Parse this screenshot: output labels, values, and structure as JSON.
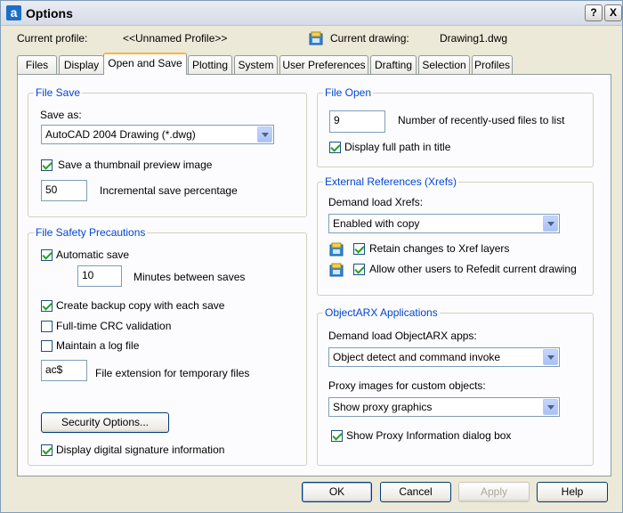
{
  "window": {
    "title": "Options",
    "app_icon_glyph": "a",
    "help_glyph": "?",
    "close_glyph": "X"
  },
  "profile": {
    "current_profile_label": "Current profile:",
    "current_profile_value": "<<Unnamed Profile>>",
    "current_drawing_label": "Current drawing:",
    "current_drawing_value": "Drawing1.dwg"
  },
  "tabs": [
    {
      "label": "Files"
    },
    {
      "label": "Display"
    },
    {
      "label": "Open and Save",
      "active": true
    },
    {
      "label": "Plotting"
    },
    {
      "label": "System"
    },
    {
      "label": "User Preferences"
    },
    {
      "label": "Drafting"
    },
    {
      "label": "Selection"
    },
    {
      "label": "Profiles"
    }
  ],
  "file_save": {
    "legend": "File Save",
    "save_as_label": "Save as:",
    "save_as_value": "AutoCAD 2004 Drawing (*.dwg)",
    "thumbnail_label": "Save a thumbnail preview image",
    "thumbnail_checked": true,
    "incremental_value": "50",
    "incremental_label": "Incremental save percentage"
  },
  "file_safety": {
    "legend": "File Safety Precautions",
    "automatic_save_label": "Automatic save",
    "automatic_save_checked": true,
    "minutes_value": "10",
    "minutes_label": "Minutes between saves",
    "backup_label": "Create backup copy with each save",
    "backup_checked": true,
    "crc_label": "Full-time CRC validation",
    "crc_checked": false,
    "log_label": "Maintain a log file",
    "log_checked": false,
    "extension_value": "ac$",
    "extension_label": "File extension for temporary files",
    "security_button": "Security Options...",
    "signature_label": "Display digital signature information",
    "signature_checked": true
  },
  "file_open": {
    "legend": "File Open",
    "recent_value": "9",
    "recent_label": "Number of recently-used files to list",
    "full_path_label": "Display full path in title",
    "full_path_checked": true
  },
  "xrefs": {
    "legend": "External References (Xrefs)",
    "demand_label": "Demand load Xrefs:",
    "demand_value": "Enabled with copy",
    "retain_label": "Retain changes to Xref layers",
    "retain_checked": true,
    "refedit_label": "Allow other users to Refedit current drawing",
    "refedit_checked": true
  },
  "objectarx": {
    "legend": "ObjectARX Applications",
    "demand_label": "Demand load ObjectARX apps:",
    "demand_value": "Object detect and command invoke",
    "proxy_label": "Proxy images for custom objects:",
    "proxy_value": "Show proxy graphics",
    "proxy_dialog_label": "Show Proxy Information dialog box",
    "proxy_dialog_checked": true
  },
  "buttons": {
    "ok": "OK",
    "cancel": "Cancel",
    "apply": "Apply",
    "help": "Help"
  },
  "colors": {
    "accent": "#0046d5",
    "active_tab_highlight": "#f9b53d",
    "check_green": "#21a121"
  }
}
